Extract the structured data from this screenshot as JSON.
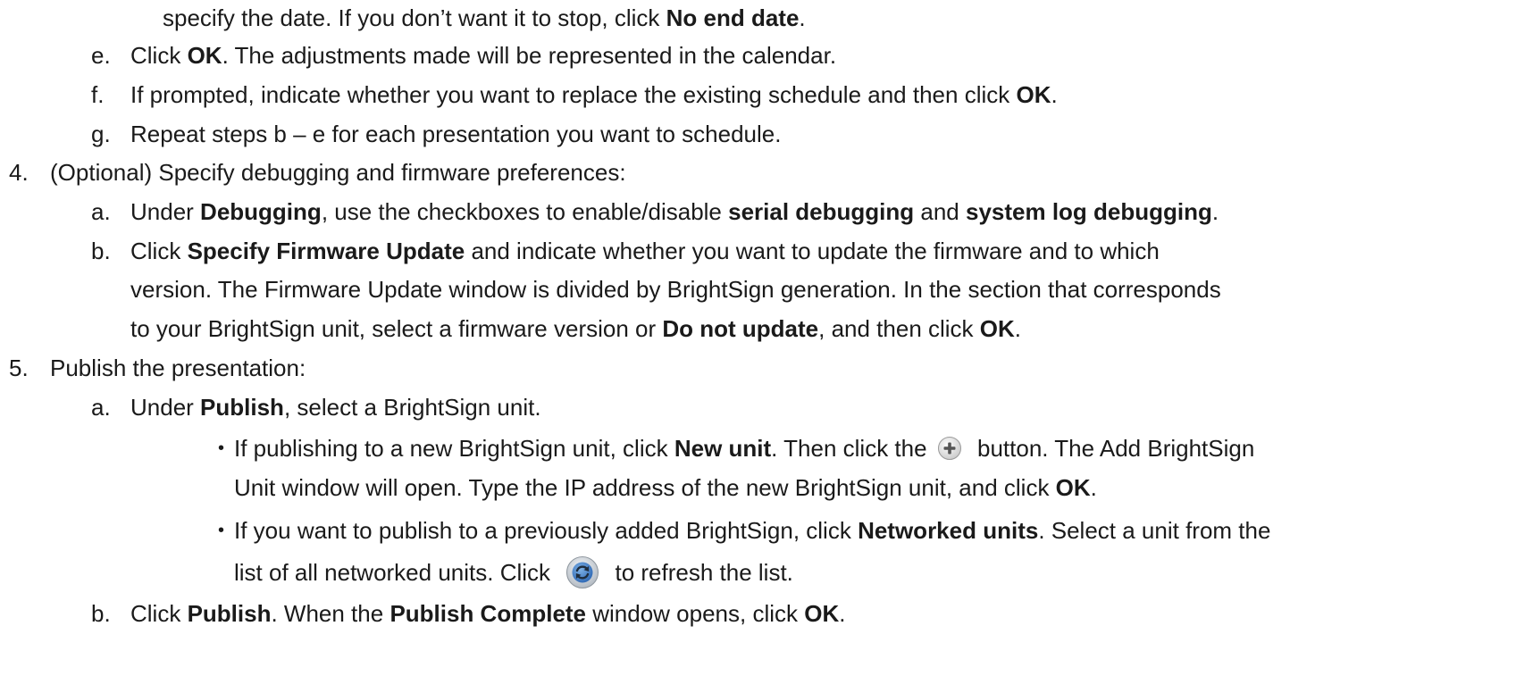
{
  "lines": {
    "d_cont": "specify the date. If you don’t want it to stop, click ",
    "d_bold": "No end date",
    "d_end": ".",
    "e_mk": "e.",
    "e_pre": "Click ",
    "e_bold": "OK",
    "e_post": ". The adjustments made will be represented in the calendar.",
    "f_mk": "f.",
    "f_pre": "If prompted, indicate whether you want to replace the existing schedule and then click ",
    "f_bold": "OK",
    "f_end": ".",
    "g_mk": "g.",
    "g_text": "Repeat steps b – e for each presentation you want to schedule.",
    "s4_mk": "4.",
    "s4_text": "(Optional) Specify debugging and firmware preferences:",
    "s4a_mk": "a.",
    "s4a_pre": "Under ",
    "s4a_b1": "Debugging",
    "s4a_mid": ", use the checkboxes to enable/disable ",
    "s4a_b2": "serial debugging",
    "s4a_and": " and ",
    "s4a_b3": "system log debugging",
    "s4a_end": ".",
    "s4b_mk": "b.",
    "s4b_pre": "Click ",
    "s4b_bold": "Specify Firmware Update",
    "s4b_post": " and indicate whether you want to update the firmware and to which",
    "s4b_l2": "version. The Firmware Update window is divided by BrightSign generation. In the section that corresponds",
    "s4b_l3_pre": "to your BrightSign unit, select a firmware version or ",
    "s4b_l3_bold": "Do not update",
    "s4b_l3_mid": ", and then click ",
    "s4b_l3_b2": "OK",
    "s4b_l3_end": ".",
    "s5_mk": "5.",
    "s5_text": "Publish the presentation:",
    "s5a_mk": "a.",
    "s5a_pre": "Under ",
    "s5a_bold": "Publish",
    "s5a_post": ", select a BrightSign unit.",
    "bul1_pre": "If publishing to a new BrightSign unit, click ",
    "bul1_bold": "New unit",
    "bul1_mid": ". Then click the ",
    "bul1_post": " button. The Add BrightSign",
    "bul1_l2_pre": "Unit window will open. Type the IP address of the new BrightSign unit, and click ",
    "bul1_l2_bold": "OK",
    "bul1_l2_end": ".",
    "bul2_pre": "If you want to publish to a previously added BrightSign, click ",
    "bul2_bold": "Networked units",
    "bul2_post": ". Select a unit from the",
    "bul2_l2_pre": "list of all networked units. Click ",
    "bul2_l2_post": " to refresh the list.",
    "s5b_mk": "b.",
    "s5b_pre": "Click ",
    "s5b_b1": "Publish",
    "s5b_mid": ". When the ",
    "s5b_b2": "Publish Complete",
    "s5b_mid2": " window opens, click ",
    "s5b_b3": "OK",
    "s5b_end": "."
  },
  "icons": {
    "plus": "plus-circle-icon",
    "refresh": "refresh-icon",
    "bullet": "•"
  }
}
